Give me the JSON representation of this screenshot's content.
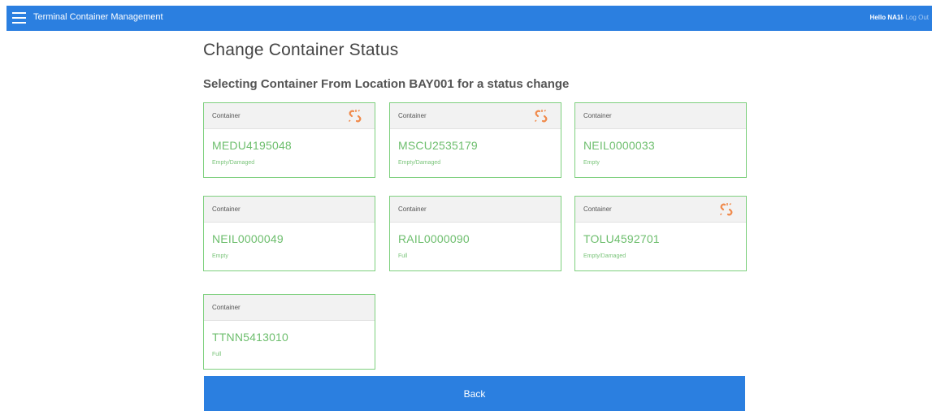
{
  "header": {
    "app_title": "Terminal Container Management",
    "greeting": "Hello NA1!",
    "logout_label": "Log Out",
    "color": "#2b7fe0"
  },
  "page": {
    "title": "Change Container Status",
    "subtitle": "Selecting Container From Location BAY001 for a status change"
  },
  "containers": [
    {
      "label": "Container",
      "id": "MEDU4195048",
      "status": "Empty/Damaged",
      "icon": "unlink-icon"
    },
    {
      "label": "Container",
      "id": "MSCU2535179",
      "status": "Empty/Damaged",
      "icon": "unlink-icon"
    },
    {
      "label": "Container",
      "id": "NEIL0000033",
      "status": "Empty",
      "icon": ""
    },
    {
      "label": "Container",
      "id": "NEIL0000049",
      "status": "Empty",
      "icon": ""
    },
    {
      "label": "Container",
      "id": "RAIL0000090",
      "status": "Full",
      "icon": ""
    },
    {
      "label": "Container",
      "id": "TOLU4592701",
      "status": "Empty/Damaged",
      "icon": "unlink-icon"
    },
    {
      "label": "Container",
      "id": "TTNN5413010",
      "status": "Full",
      "icon": ""
    }
  ],
  "actions": {
    "back_label": "Back"
  },
  "colors": {
    "accent": "#2b7fe0",
    "card_border": "#7ed07e",
    "container_id": "#6dbe6d",
    "unlink_icon": "#f08a4b"
  }
}
